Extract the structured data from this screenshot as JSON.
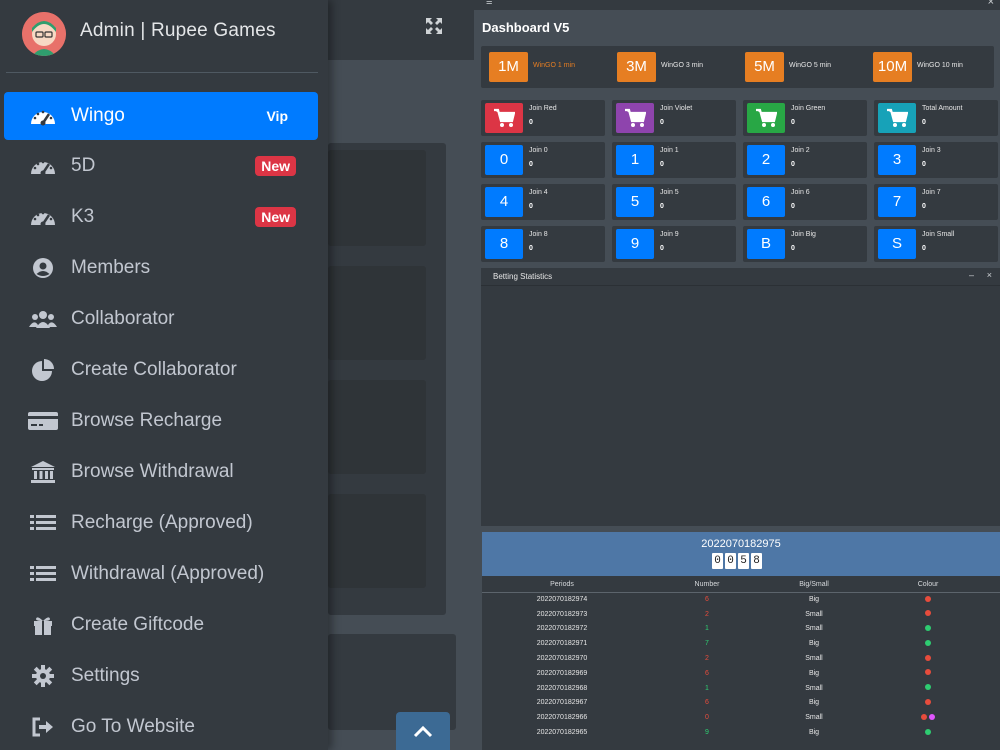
{
  "brand": {
    "title": "Admin | Rupee Games"
  },
  "sidebar": {
    "items": [
      {
        "label": "Wingo",
        "icon": "tachometer-icon",
        "badge": "Vip",
        "active": true
      },
      {
        "label": "5D",
        "icon": "tachometer-icon",
        "badge": "New"
      },
      {
        "label": "K3",
        "icon": "tachometer-icon",
        "badge": "New"
      },
      {
        "label": "Members",
        "icon": "user-circle-icon"
      },
      {
        "label": "Collaborator",
        "icon": "users-icon"
      },
      {
        "label": "Create Collaborator",
        "icon": "pie-chart-icon"
      },
      {
        "label": "Browse Recharge",
        "icon": "credit-card-icon"
      },
      {
        "label": "Browse Withdrawal",
        "icon": "bank-icon"
      },
      {
        "label": "Recharge (Approved)",
        "icon": "list-icon"
      },
      {
        "label": "Withdrawal (Approved)",
        "icon": "list-icon"
      },
      {
        "label": "Create Giftcode",
        "icon": "gift-icon"
      },
      {
        "label": "Settings",
        "icon": "gear-icon"
      },
      {
        "label": "Go To Website",
        "icon": "sign-out-icon"
      }
    ]
  },
  "dashboard": {
    "title": "Dashboard V5",
    "timers": [
      {
        "num": "1M",
        "label": "WinGO 1 min",
        "active": true
      },
      {
        "num": "3M",
        "label": "WinGO 3 min"
      },
      {
        "num": "5M",
        "label": "WinGO 5 min"
      },
      {
        "num": "10M",
        "label": "WinGO 10 min"
      }
    ],
    "joins": [
      {
        "icon": "cart-icon",
        "title": "Join Red",
        "value": "0",
        "color": "#dc3545"
      },
      {
        "icon": "cart-icon",
        "title": "Join Violet",
        "value": "0",
        "color": "#8e44ad"
      },
      {
        "icon": "cart-icon",
        "title": "Join Green",
        "value": "0",
        "color": "#28a745"
      },
      {
        "icon": "cart-icon",
        "title": "Total Amount",
        "value": "0",
        "color": "#17a2b8"
      },
      {
        "sq": "0",
        "title": "Join 0",
        "value": "0",
        "color": "#007bff"
      },
      {
        "sq": "1",
        "title": "Join 1",
        "value": "0",
        "color": "#007bff"
      },
      {
        "sq": "2",
        "title": "Join 2",
        "value": "0",
        "color": "#007bff"
      },
      {
        "sq": "3",
        "title": "Join 3",
        "value": "0",
        "color": "#007bff"
      },
      {
        "sq": "4",
        "title": "Join 4",
        "value": "0",
        "color": "#007bff"
      },
      {
        "sq": "5",
        "title": "Join 5",
        "value": "0",
        "color": "#007bff"
      },
      {
        "sq": "6",
        "title": "Join 6",
        "value": "0",
        "color": "#007bff"
      },
      {
        "sq": "7",
        "title": "Join 7",
        "value": "0",
        "color": "#007bff"
      },
      {
        "sq": "8",
        "title": "Join 8",
        "value": "0",
        "color": "#007bff"
      },
      {
        "sq": "9",
        "title": "Join 9",
        "value": "0",
        "color": "#007bff"
      },
      {
        "sq": "B",
        "title": "Join Big",
        "value": "0",
        "color": "#007bff"
      },
      {
        "sq": "S",
        "title": "Join Small",
        "value": "0",
        "color": "#007bff"
      }
    ],
    "stats_title": "Betting Statistics",
    "stats_min": "–",
    "stats_close": "×",
    "period": "2022070182975",
    "countdown": [
      "0",
      "0",
      "5",
      "8"
    ],
    "table_headers": {
      "periods": "Periods",
      "number": "Number",
      "bigsmall": "Big/Small",
      "colour": "Colour"
    },
    "rows": [
      {
        "period": "2022070182974",
        "number": "6",
        "size": "Big",
        "colors": [
          "red"
        ]
      },
      {
        "period": "2022070182973",
        "number": "2",
        "size": "Small",
        "colors": [
          "red"
        ]
      },
      {
        "period": "2022070182972",
        "number": "1",
        "size": "Small",
        "colors": [
          "green"
        ]
      },
      {
        "period": "2022070182971",
        "number": "7",
        "size": "Big",
        "colors": [
          "green"
        ]
      },
      {
        "period": "2022070182970",
        "number": "2",
        "size": "Small",
        "colors": [
          "red"
        ]
      },
      {
        "period": "2022070182969",
        "number": "6",
        "size": "Big",
        "colors": [
          "red"
        ]
      },
      {
        "period": "2022070182968",
        "number": "1",
        "size": "Small",
        "colors": [
          "green"
        ]
      },
      {
        "period": "2022070182967",
        "number": "6",
        "size": "Big",
        "colors": [
          "red"
        ]
      },
      {
        "period": "2022070182966",
        "number": "0",
        "size": "Small",
        "colors": [
          "red",
          "violet"
        ]
      },
      {
        "period": "2022070182965",
        "number": "9",
        "size": "Big",
        "colors": [
          "green"
        ]
      }
    ]
  },
  "colors": {
    "red": "#e74c3c",
    "green": "#2ecc71",
    "violet": "#e056fd",
    "accent": "#007bff",
    "orange": "#e67e22"
  }
}
